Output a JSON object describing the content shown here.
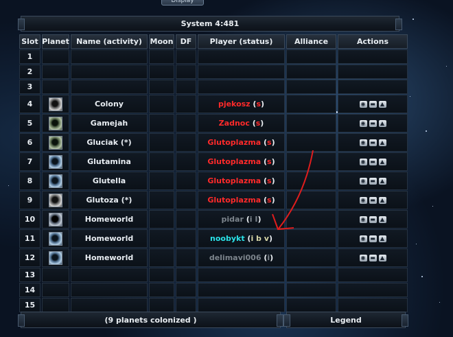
{
  "top_button": "Display",
  "system_title": "System 4:481",
  "headers": [
    "Slot",
    "Planet",
    "Name (activity)",
    "Moon",
    "DF",
    "Player (status)",
    "Alliance",
    "Actions"
  ],
  "rows": [
    {
      "slot": "1",
      "name": "",
      "player": "",
      "status": "",
      "status_class": ""
    },
    {
      "slot": "2",
      "name": "",
      "player": "",
      "status": "",
      "status_class": ""
    },
    {
      "slot": "3",
      "name": "",
      "player": "",
      "status": "",
      "status_class": ""
    },
    {
      "slot": "4",
      "name": "Colony",
      "player": "pjekosz",
      "player_class": "red",
      "status": "s",
      "status_class": "red",
      "planet": "p-grey"
    },
    {
      "slot": "5",
      "name": "Gamejah",
      "player": "Zadnoc",
      "player_class": "red",
      "status": "s",
      "status_class": "red",
      "planet": "p-green"
    },
    {
      "slot": "6",
      "name": "Gluciak (*)",
      "player": "Glutoplazma",
      "player_class": "red",
      "status": "s",
      "status_class": "red",
      "planet": "p-green"
    },
    {
      "slot": "7",
      "name": "Glutamina",
      "player": "Glutoplazma",
      "player_class": "red",
      "status": "s",
      "status_class": "red",
      "planet": "p-blue"
    },
    {
      "slot": "8",
      "name": "Glutella",
      "player": "Glutoplazma",
      "player_class": "red",
      "status": "s",
      "status_class": "red",
      "planet": "p-blue"
    },
    {
      "slot": "9",
      "name": "Glutoza (*)",
      "player": "Glutoplazma",
      "player_class": "red",
      "status": "s",
      "status_class": "red",
      "planet": "p-grey"
    },
    {
      "slot": "10",
      "name": "Homeworld",
      "player": "pidar",
      "player_class": "grey",
      "status": "i I",
      "status_class": "grey",
      "planet": ""
    },
    {
      "slot": "11",
      "name": "Homeworld",
      "player": "noobykt",
      "player_class": "cyan",
      "status": "i b v",
      "status_class": "olive",
      "planet": "p-blue"
    },
    {
      "slot": "12",
      "name": "Homeworld",
      "player": "delimavi006",
      "player_class": "grey",
      "status": "i",
      "status_class": "grey",
      "planet": "p-blue"
    },
    {
      "slot": "13",
      "name": "",
      "player": "",
      "status": "",
      "status_class": ""
    },
    {
      "slot": "14",
      "name": "",
      "player": "",
      "status": "",
      "status_class": ""
    },
    {
      "slot": "15",
      "name": "",
      "player": "",
      "status": "",
      "status_class": ""
    }
  ],
  "footer_colonized": "(9 planets colonized )",
  "footer_legend": "Legend",
  "action_icons": [
    "eye-icon",
    "message-icon",
    "buddy-icon"
  ],
  "colors": {
    "inactive": "#7c848c",
    "enemy": "#ff2a2a",
    "noob": "#2ae2e8",
    "annotation": "#e11d1d"
  }
}
